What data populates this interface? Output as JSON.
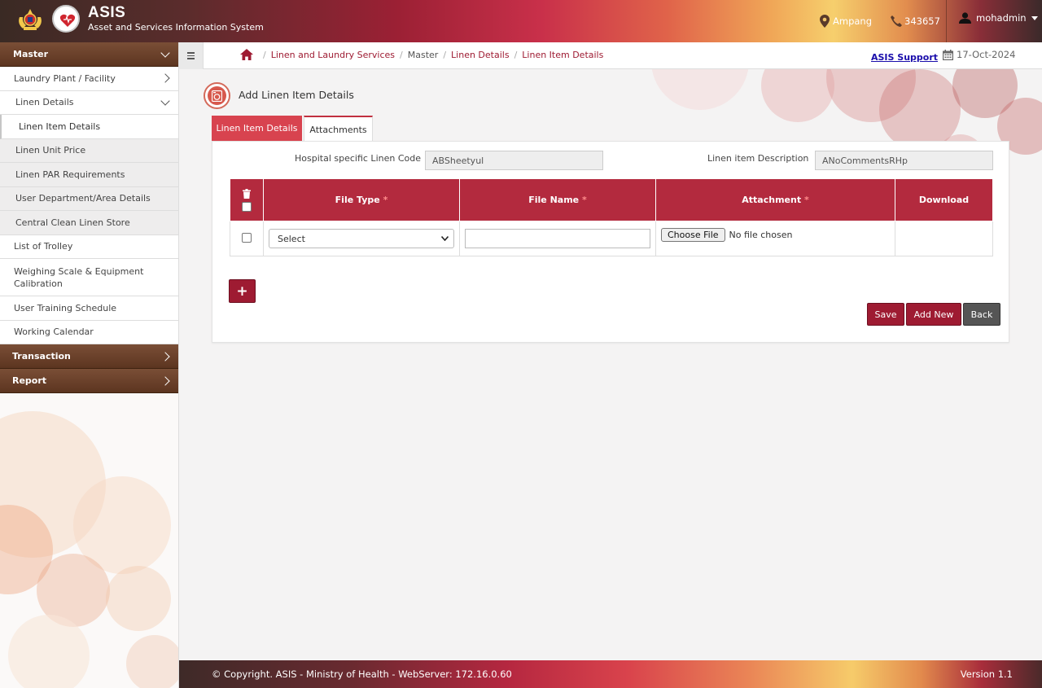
{
  "header": {
    "title": "ASIS",
    "subtitle": "Asset and Services Information System",
    "location": "Ampang",
    "phone": "343657",
    "user": "mohadmin"
  },
  "sidebar": {
    "sections": [
      {
        "label": "Master"
      },
      {
        "label": "Transaction"
      },
      {
        "label": "Report"
      }
    ],
    "items": [
      {
        "label": "Laundry Plant / Facility"
      },
      {
        "label": "Linen Details"
      },
      {
        "label": "Linen Item Details"
      },
      {
        "label": "Linen Unit Price"
      },
      {
        "label": "Linen PAR Requirements"
      },
      {
        "label": "User Department/Area Details"
      },
      {
        "label": "Central Clean Linen Store"
      },
      {
        "label": "List of Trolley"
      },
      {
        "label": "Weighing Scale & Equipment Calibration"
      },
      {
        "label": "User Training Schedule"
      },
      {
        "label": "Working Calendar"
      }
    ]
  },
  "breadcrumb": {
    "items": [
      "Linen and Laundry Services",
      "Master",
      "Linen Details",
      "Linen Item Details"
    ]
  },
  "topbar": {
    "support_link": "ASIS Support",
    "date": "17-Oct-2024"
  },
  "page": {
    "title": "Add Linen Item Details",
    "tabs": [
      {
        "label": "Linen Item Details"
      },
      {
        "label": "Attachments"
      }
    ]
  },
  "form": {
    "linen_code_label": "Hospital specific Linen Code",
    "linen_code_value": "ABSheetyul",
    "description_label": "Linen item Description",
    "description_value": "ANoCommentsRHp"
  },
  "table": {
    "headers": {
      "file_type": "File Type",
      "file_name": "File Name",
      "attachment": "Attachment",
      "download": "Download",
      "required_mark": "*"
    },
    "rows": [
      {
        "file_type": "Select",
        "file_name": "",
        "choose_file": "Choose File",
        "file_status": "No file chosen"
      }
    ]
  },
  "buttons": {
    "add_row": "+",
    "save": "Save",
    "add_new": "Add New",
    "back": "Back"
  },
  "footer": {
    "copyright": "© Copyright. ASIS - Ministry of Health - WebServer: 172.16.0.60",
    "version": "Version 1.1"
  }
}
